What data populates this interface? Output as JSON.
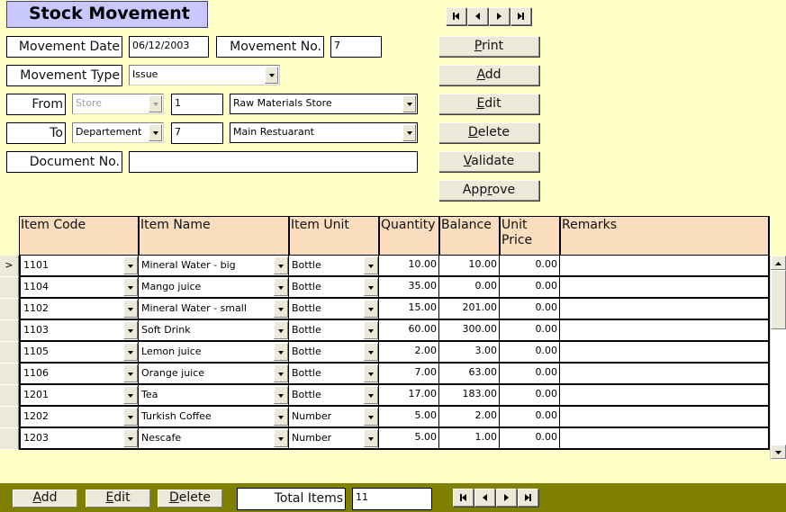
{
  "title": "Stock Movement",
  "colors": {
    "background": "#ffffc8",
    "title_bg": "#c8c8ff",
    "header_bg": "#fadcbe",
    "footer_bg": "#808000"
  },
  "form": {
    "movement_date_label": "Movement Date",
    "movement_date_value": "06/12/2003",
    "movement_no_label": "Movement No.",
    "movement_no_value": "7",
    "movement_type_label": "Movement Type",
    "movement_type_value": "Issue",
    "from_label": "From",
    "from_type_value": "Store",
    "from_code_value": "1",
    "from_name_value": "Raw Materials Store",
    "to_label": "To",
    "to_type_value": "Departement",
    "to_code_value": "7",
    "to_name_value": "Main Restuarant",
    "document_no_label": "Document No.",
    "document_no_value": ""
  },
  "record_nav": {
    "icons": [
      "first-record-icon",
      "previous-record-icon",
      "next-record-icon",
      "last-record-icon"
    ]
  },
  "actions": {
    "print": {
      "label": "Print",
      "accel": "P"
    },
    "add": {
      "label": "Add",
      "accel": "A"
    },
    "edit": {
      "label": "Edit",
      "accel": "E"
    },
    "delete": {
      "label": "Delete",
      "accel": "D"
    },
    "validate": {
      "label": "Validate",
      "accel": "V"
    },
    "approve": {
      "label": "Approve",
      "accel": "r"
    }
  },
  "grid": {
    "columns": [
      "Item Code",
      "Item Name",
      "Item Unit",
      "Quantity",
      "Balance",
      "Unit Price",
      "Remarks"
    ],
    "current_row_marker": ">",
    "rows": [
      {
        "code": "1101",
        "name": "Mineral Water - big",
        "unit": "Bottle",
        "quantity": "10.00",
        "balance": "10.00",
        "unit_price": "0.00",
        "remarks": ""
      },
      {
        "code": "1104",
        "name": "Mango juice",
        "unit": "Bottle",
        "quantity": "35.00",
        "balance": "0.00",
        "unit_price": "0.00",
        "remarks": ""
      },
      {
        "code": "1102",
        "name": "Mineral Water - small",
        "unit": "Bottle",
        "quantity": "15.00",
        "balance": "201.00",
        "unit_price": "0.00",
        "remarks": ""
      },
      {
        "code": "1103",
        "name": "Soft Drink",
        "unit": "Bottle",
        "quantity": "60.00",
        "balance": "300.00",
        "unit_price": "0.00",
        "remarks": ""
      },
      {
        "code": "1105",
        "name": "Lemon juice",
        "unit": "Bottle",
        "quantity": "2.00",
        "balance": "3.00",
        "unit_price": "0.00",
        "remarks": ""
      },
      {
        "code": "1106",
        "name": "Orange juice",
        "unit": "Bottle",
        "quantity": "7.00",
        "balance": "63.00",
        "unit_price": "0.00",
        "remarks": ""
      },
      {
        "code": "1201",
        "name": "Tea",
        "unit": "Bottle",
        "quantity": "17.00",
        "balance": "183.00",
        "unit_price": "0.00",
        "remarks": ""
      },
      {
        "code": "1202",
        "name": "Turkish Coffee",
        "unit": "Number",
        "quantity": "5.00",
        "balance": "2.00",
        "unit_price": "0.00",
        "remarks": ""
      },
      {
        "code": "1203",
        "name": "Nescafe",
        "unit": "Number",
        "quantity": "5.00",
        "balance": "1.00",
        "unit_price": "0.00",
        "remarks": ""
      }
    ]
  },
  "footer": {
    "add": {
      "label": "Add",
      "accel": "A"
    },
    "edit": {
      "label": "Edit",
      "accel": "E"
    },
    "delete": {
      "label": "Delete",
      "accel": "D"
    },
    "total_items_label": "Total Items",
    "total_items_value": "11"
  }
}
